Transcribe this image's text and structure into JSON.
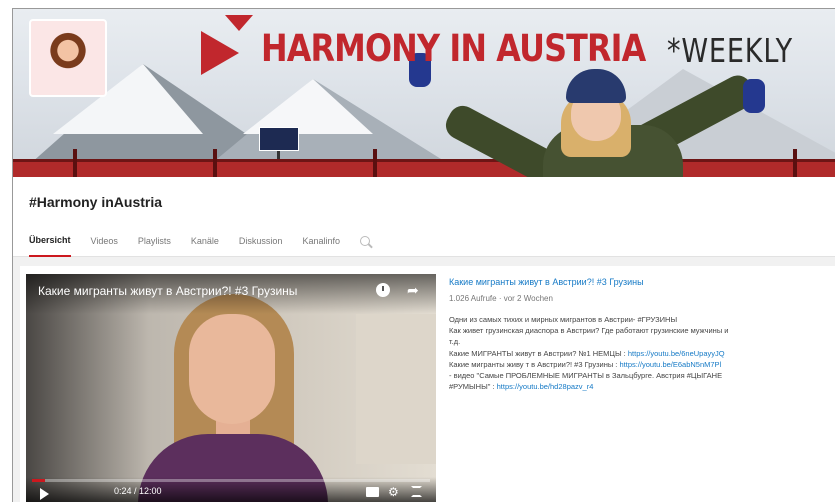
{
  "banner": {
    "title": "HARMONY IN AUSTRIA",
    "weekly": "*WEEKLY",
    "accent_color": "#c1272d"
  },
  "channel": {
    "name": "#Harmony inAustria"
  },
  "tabs": [
    {
      "label": "Übersicht",
      "active": true
    },
    {
      "label": "Videos",
      "active": false
    },
    {
      "label": "Playlists",
      "active": false
    },
    {
      "label": "Kanäle",
      "active": false
    },
    {
      "label": "Diskussion",
      "active": false
    },
    {
      "label": "Kanalinfo",
      "active": false
    }
  ],
  "video": {
    "overlay_title": "Какие мигранты живут в Австрии?! #3 Грузины",
    "time": "0:24 / 12:00",
    "progress_fraction": 0.033,
    "progress_color": "#cc181e"
  },
  "info": {
    "title": "Какие мигранты живут в Австрии?! #3 Грузины",
    "meta": "1.026 Aufrufe · vor 2 Wochen",
    "desc_1": "Одни из самых тихих и мирных мигрантов в Австрии- #ГРУЗИНЫ",
    "desc_2": "Как живет грузинская диаспора в Австрии? Где работают грузинские мужчины и",
    "desc_3": "т.д.",
    "desc_4_text": "Какие МИГРАНТЫ живут в Австрии? №1 НЕМЦЫ :",
    "desc_4_link": "https://youtu.be/6neUpayyJQ",
    "desc_5_text": "Какие мигранты живу т в Австрии?! #3 Грузины :",
    "desc_5_link": "https://youtu.be/E6abN5nM7Pl",
    "desc_6": "- видео \"Самые ПРОБЛЕМНЫЕ МИГРАНТЫ в Зальцбурге. Австрия #ЦЫГАНЕ",
    "desc_7_text": "#РУМЫНЫ\" :",
    "desc_7_link": "https://youtu.be/hd28pazv_r4",
    "link_color": "#167ac6"
  }
}
